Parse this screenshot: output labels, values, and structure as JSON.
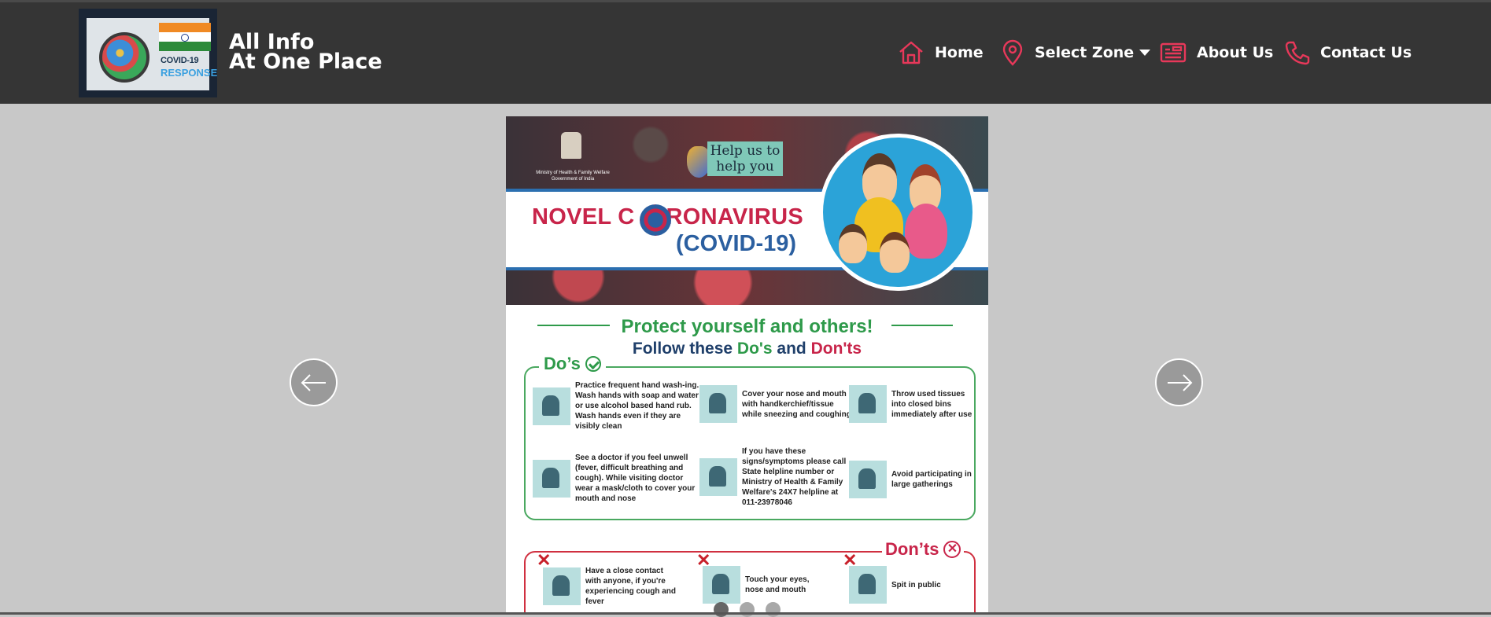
{
  "header": {
    "logo": {
      "line1": "COVID-19",
      "line2": "RESPONSE"
    },
    "brand_line1": "All Info",
    "brand_line2": "At One Place",
    "nav": [
      {
        "label": "Home",
        "icon": "home-icon"
      },
      {
        "label": "Select Zone",
        "icon": "map-pin-icon"
      },
      {
        "label": "About Us",
        "icon": "newspaper-icon"
      },
      {
        "label": "Contact Us",
        "icon": "phone-icon"
      }
    ],
    "accent_color": "#e8385a"
  },
  "slide": {
    "ministry": "Ministry of Health & Family Welfare\nGovernment of India",
    "help_tag": "Help us to help you",
    "title_left": "NOVEL C",
    "title_right": "RONAVIRUS",
    "title_sub": "(COVID-19)",
    "protect": "Protect yourself and others!",
    "follow_prefix": "Follow these ",
    "follow_dos": "Do's",
    "follow_and": " and ",
    "follow_donts": "Don'ts",
    "dos_title": "Do’s",
    "dos": [
      "Practice frequent hand wash-ing. Wash hands with soap and water or use alcohol based hand rub. Wash hands even if they are visibly clean",
      "Cover your nose and mouth with handkerchief/tissue while sneezing and coughing",
      "Throw used tissues into closed bins immediately after use",
      "See a doctor if you feel unwell (fever, difficult breathing and cough). While visiting doctor wear a mask/cloth to cover your mouth and nose",
      "If you have these signs/symptoms please call State helpline number or Ministry of Health & Family Welfare's 24X7 helpline at 011-23978046",
      "Avoid participating in large gatherings"
    ],
    "donts_title": "Don’ts",
    "donts": [
      "Have a close contact with anyone, if you're experiencing cough and fever",
      "Touch your eyes, nose and mouth",
      "Spit in public"
    ],
    "colors": {
      "green": "#2e9a4a",
      "red": "#c8254a",
      "blue": "#2b5fa0"
    }
  },
  "carousel": {
    "slide_count": 3,
    "active_index": 0
  }
}
